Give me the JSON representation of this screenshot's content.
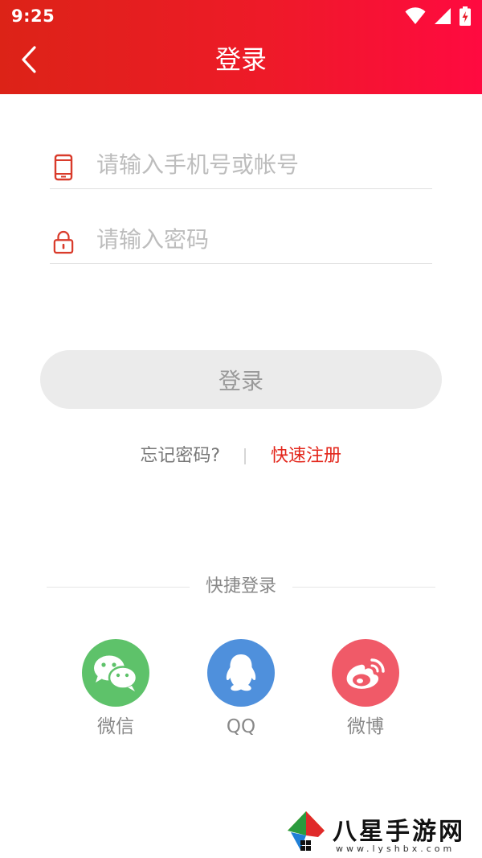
{
  "status_bar": {
    "time": "9:25"
  },
  "header": {
    "title": "登录"
  },
  "form": {
    "account_placeholder": "请输入手机号或帐号",
    "password_placeholder": "请输入密码",
    "login_label": "登录"
  },
  "links": {
    "forgot": "忘记密码?",
    "register": "快速注册"
  },
  "quick_login": {
    "title": "快捷登录",
    "items": [
      {
        "label": "微信",
        "icon": "wechat-icon"
      },
      {
        "label": "QQ",
        "icon": "qq-icon"
      },
      {
        "label": "微博",
        "icon": "weibo-icon"
      }
    ]
  },
  "watermark": {
    "text": "八星手游网",
    "url": "www.lyshbx.com"
  },
  "colors": {
    "header_start": "#dc2317",
    "header_end": "#ff0a40",
    "accent_red": "#e3261b",
    "wechat": "#5ec26a",
    "qq": "#4f90dc",
    "weibo": "#f05a68"
  }
}
